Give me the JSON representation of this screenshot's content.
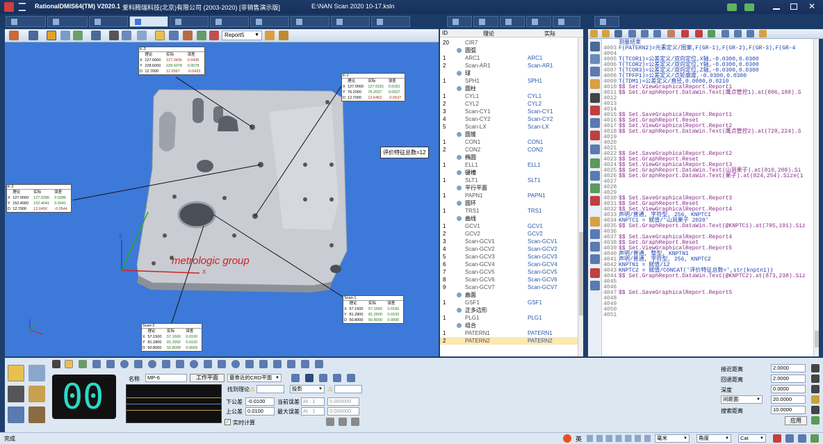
{
  "title": {
    "app": "RationalDMIS64(TM) V2020.1",
    "company": "爱科腾瑞科技(北京)有限公司 (2003-2020) [非销售演示版]",
    "file": "E:\\NAN Scan  2020 10-17.ksln"
  },
  "toolbar": {
    "report_select": "Report5"
  },
  "view": {
    "count_label": "评价特征总数=12",
    "brand": "metrologic group",
    "axis_z": "Z",
    "axis_x": "X",
    "axis_y": "Y"
  },
  "labels": [
    {
      "title": "K-3",
      "head": [
        "",
        "理论",
        "实际",
        "误差"
      ],
      "rows": [
        [
          "X",
          "127.0000",
          "127.0435",
          "0.0435"
        ],
        [
          "Y",
          "228.6000",
          "228.6078",
          "0.0078"
        ],
        [
          "D",
          "12.7000",
          "12.6567",
          "-0.0433"
        ]
      ]
    },
    {
      "title": "K-1",
      "head": [
        "",
        "理论",
        "实际",
        "误差"
      ],
      "rows": [
        [
          "X",
          "127.0000",
          "127.0181",
          "0.0181"
        ],
        [
          "Y",
          "76.2000",
          "76.2037",
          "0.0037"
        ],
        [
          "D",
          "12.7000",
          "12.6463",
          "-0.0537"
        ]
      ]
    },
    {
      "title": "K-2",
      "head": [
        "",
        "理论",
        "实际",
        "误差"
      ],
      "rows": [
        [
          "X",
          "127.0000",
          "127.0286",
          "0.0286"
        ],
        [
          "Y",
          "152.4000",
          "152.4041",
          "0.0041"
        ],
        [
          "D",
          "12.7000",
          "12.6456",
          "-0.0544"
        ]
      ]
    },
    {
      "title": "Scan-1",
      "head": [
        "",
        "理论",
        "实际",
        "误差"
      ],
      "rows": [
        [
          "X",
          "57.1500",
          "57.1660",
          "0.0160"
        ],
        [
          "Y",
          "81.2800",
          "81.2900",
          "0.0100"
        ],
        [
          "D",
          "50.8000",
          "50.8000",
          "0.0000"
        ]
      ]
    },
    {
      "title": "Scan-2",
      "head": [
        "",
        "理论",
        "实际",
        "误差"
      ],
      "rows": [
        [
          "X",
          "57.1500",
          "57.1660",
          "0.0160"
        ],
        [
          "Y",
          "81.2800",
          "81.2902",
          "0.0102"
        ],
        [
          "D",
          "50.8000",
          "50.8009",
          "0.0009"
        ]
      ]
    }
  ],
  "tree": {
    "col_id": "ID",
    "col_nominal": "理论",
    "col_actual": "实际",
    "rows": [
      {
        "id": "20",
        "name": "CIR7",
        "actual": "",
        "group": false
      },
      {
        "id": "",
        "name": "圆弧",
        "actual": "",
        "group": true
      },
      {
        "id": "1",
        "name": "ARC1",
        "actual": "ARC1",
        "group": false
      },
      {
        "id": "2",
        "name": "Scan-AR1",
        "actual": "Scan-AR1",
        "group": false
      },
      {
        "id": "",
        "name": "球",
        "actual": "",
        "group": true
      },
      {
        "id": "1",
        "name": "SPH1",
        "actual": "SPH1",
        "group": false
      },
      {
        "id": "",
        "name": "圆柱",
        "actual": "",
        "group": true
      },
      {
        "id": "1",
        "name": "CYL1",
        "actual": "CYL1",
        "group": false
      },
      {
        "id": "2",
        "name": "CYL2",
        "actual": "CYL2",
        "group": false
      },
      {
        "id": "3",
        "name": "Scan-CY1",
        "actual": "Scan-CY1",
        "group": false
      },
      {
        "id": "4",
        "name": "Scan-CY2",
        "actual": "Scan-CY2",
        "group": false
      },
      {
        "id": "5",
        "name": "Scan-LX",
        "actual": "Scan-LX",
        "group": false
      },
      {
        "id": "",
        "name": "圆锥",
        "actual": "",
        "group": true
      },
      {
        "id": "1",
        "name": "CON1",
        "actual": "CON1",
        "group": false
      },
      {
        "id": "2",
        "name": "CON2",
        "actual": "CON2",
        "group": false
      },
      {
        "id": "",
        "name": "椭圆",
        "actual": "",
        "group": true
      },
      {
        "id": "1",
        "name": "ELL1",
        "actual": "ELL1",
        "group": false
      },
      {
        "id": "",
        "name": "键槽",
        "actual": "",
        "group": true
      },
      {
        "id": "1",
        "name": "SLT1",
        "actual": "SLT1",
        "group": false
      },
      {
        "id": "",
        "name": "平行平面",
        "actual": "",
        "group": true
      },
      {
        "id": "1",
        "name": "PAPN1",
        "actual": "PAPN1",
        "group": false
      },
      {
        "id": "",
        "name": "圆环",
        "actual": "",
        "group": true
      },
      {
        "id": "1",
        "name": "TRS1",
        "actual": "TRS1",
        "group": false
      },
      {
        "id": "",
        "name": "曲线",
        "actual": "",
        "group": true
      },
      {
        "id": "1",
        "name": "GCV1",
        "actual": "GCV1",
        "group": false
      },
      {
        "id": "2",
        "name": "GCV2",
        "actual": "GCV2",
        "group": false
      },
      {
        "id": "3",
        "name": "Scan-GCV1",
        "actual": "Scan-GCV1",
        "group": false
      },
      {
        "id": "4",
        "name": "Scan-GCV2",
        "actual": "Scan-GCV2",
        "group": false
      },
      {
        "id": "5",
        "name": "Scan-GCV3",
        "actual": "Scan-GCV3",
        "group": false
      },
      {
        "id": "6",
        "name": "Scan-GCV4",
        "actual": "Scan-GCV4",
        "group": false
      },
      {
        "id": "7",
        "name": "Scan-GCV5",
        "actual": "Scan-GCV5",
        "group": false
      },
      {
        "id": "8",
        "name": "Scan-GCV6",
        "actual": "Scan-GCV6",
        "group": false
      },
      {
        "id": "9",
        "name": "Scan-GCV7",
        "actual": "Scan-GCV7",
        "group": false
      },
      {
        "id": "",
        "name": "曲面",
        "actual": "",
        "group": true
      },
      {
        "id": "1",
        "name": "GSF1",
        "actual": "GSF1",
        "group": false
      },
      {
        "id": "",
        "name": "正多边形",
        "actual": "",
        "group": true
      },
      {
        "id": "1",
        "name": "PLG1",
        "actual": "PLG1",
        "group": false
      },
      {
        "id": "",
        "name": "组合",
        "actual": "",
        "group": true
      },
      {
        "id": "1",
        "name": "PATERN1",
        "actual": "PATERN1",
        "group": false
      },
      {
        "id": "2",
        "name": "PATERN2",
        "actual": "PATERN2",
        "group": false
      }
    ]
  },
  "code": [
    {
      "n": "",
      "t": "测量结束",
      "c": "#1a3fb0"
    },
    {
      "n": "4003",
      "t": "F(PATERN2)=元素定义/图案,F(GR-1),F(GR-2),F(GR-3),F(GR-4",
      "c": "#1a3fb0"
    },
    {
      "n": "4004",
      "t": "",
      "c": "#000"
    },
    {
      "n": "4005",
      "t": "T(TCOR1)=公差定义/双向定位,X轴,-0.0300,0.0300",
      "c": "#1a3fb0"
    },
    {
      "n": "4006",
      "t": "T(TCOR2)=公差定义/双向定位,Y轴,-0.0300,0.0300",
      "c": "#1a3fb0"
    },
    {
      "n": "4007",
      "t": "T(TCOR3)=公差定义/双向定位,Z轴,-0.0300,0.0300",
      "c": "#1a3fb0"
    },
    {
      "n": "4008",
      "t": "T(TPFP1)=公差定义/点轮廓度,-0.0300,0.0300",
      "c": "#1a3fb0"
    },
    {
      "n": "4009",
      "t": "T(TDM1)=公差定义/直径,0.0000,0.0210",
      "c": "#1a3fb0"
    },
    {
      "n": "4010",
      "t": "$$ Set.ViewGraphicalReport.Report1",
      "c": "#8a2a8a"
    },
    {
      "n": "4011",
      "t": "$$ Set.GraphReport.DataWin.Text(鹰点管控1).at(806,188).S",
      "c": "#8a2a8a"
    },
    {
      "n": "4012",
      "t": "",
      "c": "#000"
    },
    {
      "n": "4013",
      "t": "",
      "c": "#000"
    },
    {
      "n": "4014",
      "t": "",
      "c": "#000"
    },
    {
      "n": "4015",
      "t": "$$ Set.SaveGraphicalReport.Report1",
      "c": "#8a2a8a"
    },
    {
      "n": "4016",
      "t": "$$ Set.GraphReport.Reset",
      "c": "#8a2a8a"
    },
    {
      "n": "4017",
      "t": "$$ Set.ViewGraphicalReport.Report2",
      "c": "#8a2a8a"
    },
    {
      "n": "4018",
      "t": "$$ Set.GraphReport.DataWin.Text(鹰点管控2).at(728,224).S",
      "c": "#8a2a8a"
    },
    {
      "n": "4019",
      "t": "",
      "c": "#000"
    },
    {
      "n": "4020",
      "t": "",
      "c": "#000"
    },
    {
      "n": "4021",
      "t": "",
      "c": "#000"
    },
    {
      "n": "4022",
      "t": "$$ Set.SaveGraphicalReport.Report2",
      "c": "#8a2a8a"
    },
    {
      "n": "4023",
      "t": "$$ Set.GraphReport.Reset",
      "c": "#8a2a8a"
    },
    {
      "n": "4024",
      "t": "$$ Set.ViewGraphicalReport.Report3",
      "c": "#8a2a8a"
    },
    {
      "n": "4025",
      "t": "$$ Set.GraphReport.DataWin.Text(山洞果子).at(810,208).Si",
      "c": "#8a2a8a"
    },
    {
      "n": "4026",
      "t": "$$ Set.GraphReport.DataWin.Text(果子).at(824,254).Size(1",
      "c": "#8a2a8a"
    },
    {
      "n": "4027",
      "t": "",
      "c": "#000"
    },
    {
      "n": "4028",
      "t": "",
      "c": "#000"
    },
    {
      "n": "4029",
      "t": "",
      "c": "#000"
    },
    {
      "n": "4030",
      "t": "$$ Set.SaveGraphicalReport.Report3",
      "c": "#8a2a8a"
    },
    {
      "n": "4031",
      "t": "$$ Set.GraphReport.Reset",
      "c": "#8a2a8a"
    },
    {
      "n": "4032",
      "t": "$$ Set.ViewGraphicalReport.Report4",
      "c": "#8a2a8a"
    },
    {
      "n": "4033",
      "t": "声明/普通, 字符型, 256, KNPTC1",
      "c": "#1a3fb0"
    },
    {
      "n": "4034",
      "t": "KNPTC1 = 赋值/'山洞果子 2020'",
      "c": "#1a3fb0"
    },
    {
      "n": "4035",
      "t": "$$ Set.GraphReport.DataWin.Text(@KNPTC1).at(795,191).Siz",
      "c": "#8a2a8a"
    },
    {
      "n": "4036",
      "t": "",
      "c": "#000"
    },
    {
      "n": "4037",
      "t": "$$ Set.SaveGraphicalReport.Report4",
      "c": "#8a2a8a"
    },
    {
      "n": "4038",
      "t": "$$ Set.GraphReport.Reset",
      "c": "#8a2a8a"
    },
    {
      "n": "4039",
      "t": "$$ Set.ViewGraphicalReport.Report5",
      "c": "#8a2a8a"
    },
    {
      "n": "4040",
      "t": "声明/普通, 整型, KNPTN1",
      "c": "#1a3fb0"
    },
    {
      "n": "4041",
      "t": "声明/普通, 字符型, 256, KNPTC2",
      "c": "#1a3fb0"
    },
    {
      "n": "4042",
      "t": "KNPTN1 = 赋值/12",
      "c": "#1a3fb0"
    },
    {
      "n": "4043",
      "t": "KNPTC2 = 赋值/CONCAT('评价特征总数=',str(knptn1))",
      "c": "#1a3fb0"
    },
    {
      "n": "4044",
      "t": "$$ Set.GraphReport.DataWin.Text(@KNPTC2).at(873,238).Siz",
      "c": "#8a2a8a"
    },
    {
      "n": "4045",
      "t": "",
      "c": "#000"
    },
    {
      "n": "4046",
      "t": "",
      "c": "#000"
    },
    {
      "n": "4047",
      "t": "$$ Set.SaveGraphicalReport.Report5",
      "c": "#8a2a8a"
    },
    {
      "n": "4048",
      "t": "",
      "c": "#000"
    },
    {
      "n": "4049",
      "t": "",
      "c": "#000"
    },
    {
      "n": "4050",
      "t": "",
      "c": "#000"
    },
    {
      "n": "4051",
      "t": "",
      "c": "#000"
    }
  ],
  "measure": {
    "counter": "00",
    "name_label": "名称",
    "name_value": "MP-6",
    "workplane_button": "工作平面",
    "crd_select": "最靠近的CRD平面",
    "find_nominal_label": "找到理论",
    "projection_select": "投影",
    "lower_tol_label": "下公差",
    "lower_tol_value": "-0.0100",
    "upper_tol_label": "上公差",
    "upper_tol_value": "0.0100",
    "current_err_label": "当前误差",
    "max_err_label": "最大误差",
    "at_field": "At : 1",
    "err_value": "0.000000",
    "realtime_label": "实时计算"
  },
  "approach": {
    "approach_label": "接近距离",
    "approach_value": "2.0000",
    "retract_label": "回退距离",
    "retract_value": "2.0000",
    "depth_label": "深度",
    "depth_value": "0.0000",
    "spacing_select": "间距面",
    "spacing_value": "20.0000",
    "search_label": "搜索距离",
    "search_value": "10.0000",
    "apply_button": "应用"
  },
  "status": {
    "left": "完成",
    "ime": "英",
    "unit": "毫米",
    "angle": "角度",
    "coord": "Cat"
  }
}
